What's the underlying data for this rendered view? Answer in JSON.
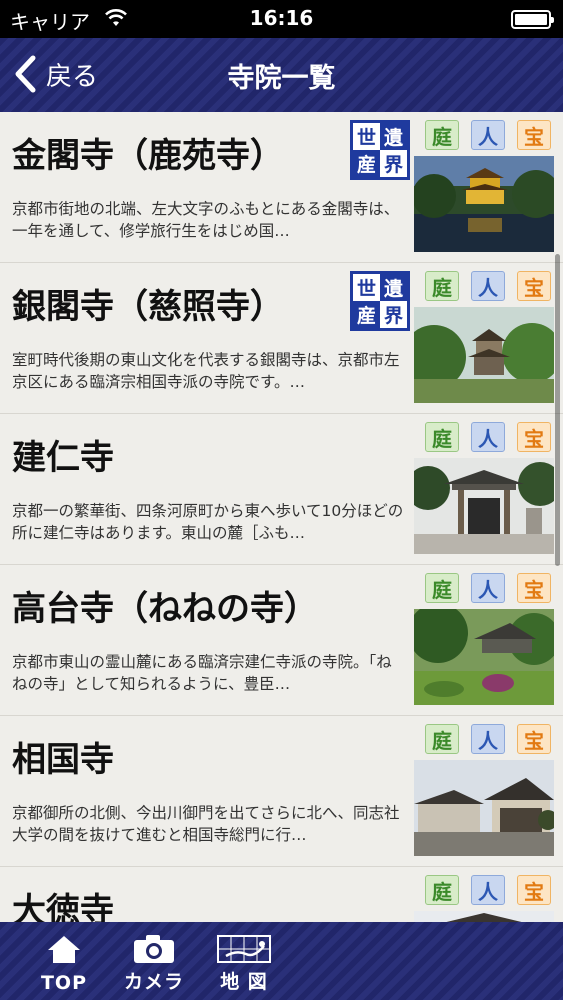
{
  "status_bar": {
    "carrier": "キャリア",
    "time": "16:16"
  },
  "nav": {
    "back_label": "戻る",
    "title": "寺院一覧"
  },
  "heritage_chars": [
    "世",
    "遺",
    "産",
    "界"
  ],
  "badge_labels": {
    "garden": "庭",
    "person": "人",
    "treasure": "宝"
  },
  "temples": [
    {
      "name": "金閣寺（鹿苑寺）",
      "description": "京都市街地の北端、左大文字のふもとにある金閣寺は、一年を通して、修学旅行生をはじめ国…",
      "heritage": true,
      "image": "golden-pavilion"
    },
    {
      "name": "銀閣寺（慈照寺）",
      "description": "室町時代後期の東山文化を代表する銀閣寺は、京都市左京区にある臨済宗相国寺派の寺院です。…",
      "heritage": true,
      "image": "silver-pavilion"
    },
    {
      "name": "建仁寺",
      "description": "京都一の繁華街、四条河原町から東へ歩いて10分ほどの所に建仁寺はあります。東山の麓［ふも…",
      "heritage": false,
      "image": "temple-gate"
    },
    {
      "name": "高台寺（ねねの寺）",
      "description": "京都市東山の霊山麓にある臨済宗建仁寺派の寺院。「ねねの寺」として知られるように、豊臣…",
      "heritage": false,
      "image": "temple-garden"
    },
    {
      "name": "相国寺",
      "description": "京都御所の北側、今出川御門を出てさらに北へ、同志社大学の間を抜けて進むと相国寺総門に行…",
      "heritage": false,
      "image": "temple-hall"
    },
    {
      "name": "大徳寺",
      "description": "",
      "heritage": false,
      "image": "temple-roof"
    }
  ],
  "tabs": [
    {
      "label": "TOP",
      "icon": "home-icon"
    },
    {
      "label": "カメラ",
      "icon": "camera-icon"
    },
    {
      "label": "地 図",
      "icon": "map-icon"
    }
  ]
}
